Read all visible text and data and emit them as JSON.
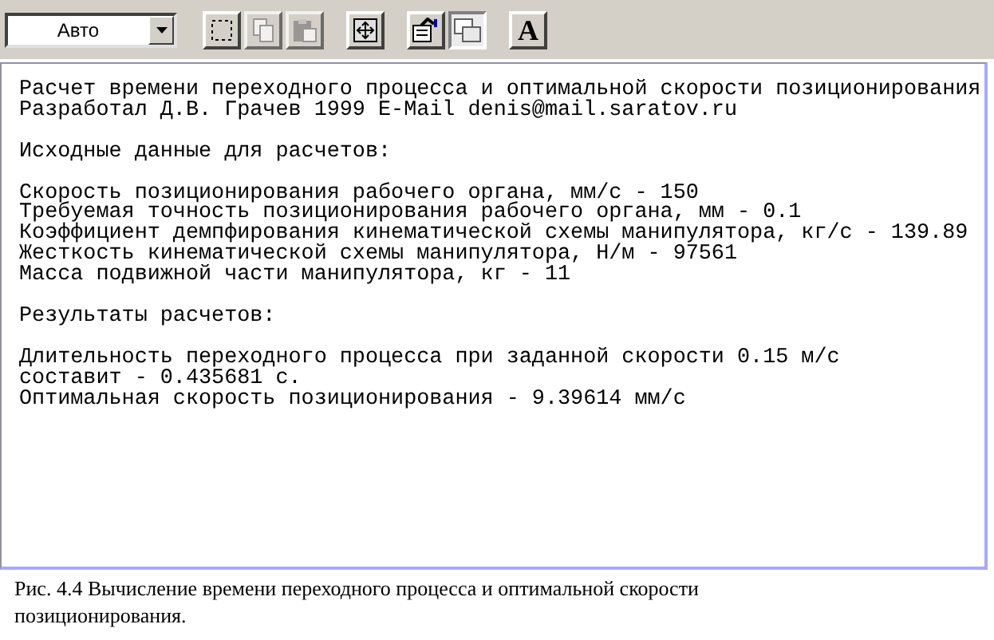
{
  "toolbar": {
    "mode_select": {
      "value": "Авто"
    },
    "buttons": [
      {
        "kind": "select",
        "pressed": false,
        "disabled": false
      },
      {
        "kind": "copy",
        "pressed": false,
        "disabled": true
      },
      {
        "kind": "paste",
        "pressed": false,
        "disabled": true
      },
      {
        "kind": "fullscreen",
        "pressed": false,
        "disabled": false
      },
      {
        "kind": "properties",
        "pressed": false,
        "disabled": false
      },
      {
        "kind": "background",
        "pressed": true,
        "disabled": false
      },
      {
        "kind": "font",
        "label": "A",
        "pressed": false,
        "disabled": false
      }
    ]
  },
  "output": {
    "header": [
      "Расчет времени переходного процесса и оптимальной скорости позиционирования",
      "Разработал Д.В. Грачев 1999 E-Mail denis@mail.saratov.ru"
    ],
    "sections": [
      {
        "title": "Исходные данные для расчетов:",
        "lines": [
          "Скорость позиционирования рабочего органа, мм/с - 150",
          "Требуемая точность позиционирования рабочего органа, мм - 0.1",
          "Коэффициент демпфирования кинематической схемы манипулятора, кг/с - 139.89",
          "Жесткость кинематической схемы манипулятора, Н/м - 97561",
          "Масса подвижной части манипулятора, кг - 11"
        ]
      },
      {
        "title": "Результаты расчетов:",
        "lines": [
          "Длительность переходного процесса при заданной скорости 0.15 м/с",
          "составит - 0.435681 с.",
          "Оптимальная скорость позиционирования - 9.39614 мм/с"
        ]
      }
    ]
  },
  "caption": "Рис. 4.4 Вычисление времени переходного процесса и оптимальной скорости позиционирования."
}
